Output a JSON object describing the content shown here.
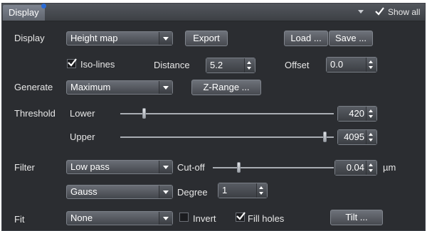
{
  "header": {
    "tab_title": "Display",
    "show_all_label": "Show all",
    "show_all_checked": true
  },
  "display": {
    "label": "Display",
    "mode": "Height map",
    "export_label": "Export",
    "load_label": "Load ...",
    "save_label": "Save ..."
  },
  "isolines": {
    "label": "Iso-lines",
    "checked": true,
    "distance_label": "Distance",
    "distance_value": "5.2",
    "offset_label": "Offset",
    "offset_value": "0.0"
  },
  "generate": {
    "label": "Generate",
    "mode": "Maximum",
    "zrange_label": "Z-Range ..."
  },
  "threshold": {
    "label": "Threshold",
    "lower_label": "Lower",
    "lower_value": "420",
    "upper_label": "Upper",
    "upper_value": "4095",
    "max": 4095
  },
  "filter": {
    "label": "Filter",
    "type": "Low pass",
    "cutoff_label": "Cut-off",
    "cutoff_value": "0.04",
    "cutoff_unit": "µm",
    "kernel": "Gauss",
    "degree_label": "Degree",
    "degree_value": "1"
  },
  "fit": {
    "label": "Fit",
    "mode": "None",
    "invert_label": "Invert",
    "invert_checked": false,
    "fill_holes_label": "Fill holes",
    "fill_holes_checked": true,
    "tilt_label": "Tilt ..."
  },
  "colors": {
    "panel_bg": "#2b2d31",
    "check_color": "#ffffff"
  }
}
